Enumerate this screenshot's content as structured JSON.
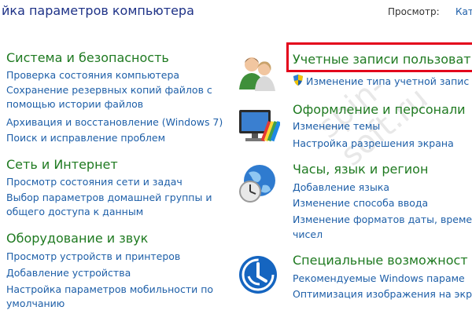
{
  "header": {
    "title": "йка параметров компьютера",
    "view_label": "Просмотр:",
    "view_value": "Кат"
  },
  "left": [
    {
      "title": "Система и безопасность",
      "links": [
        "Проверка состояния компьютера",
        "Сохранение резервных копий файлов с",
        "помощью истории файлов",
        "Архивация и восстановление (Windows 7)",
        "Поиск и исправление проблем"
      ]
    },
    {
      "title": "Сеть и Интернет",
      "links": [
        "Просмотр состояния сети и задач",
        "Выбор параметров домашней группы и",
        "общего доступа к данным"
      ]
    },
    {
      "title": "Оборудование и звук",
      "links": [
        "Просмотр устройств и принтеров",
        "Добавление устройства",
        "Настройка параметров мобильности по",
        "умолчанию"
      ]
    }
  ],
  "right": [
    {
      "title": "Учетные записи пользоват",
      "links": [
        "Изменение типа учетной запис"
      ],
      "icon": "users-icon"
    },
    {
      "title": "Оформление и персонали",
      "links": [
        "Изменение темы",
        "Настройка разрешения экрана"
      ],
      "icon": "appearance-icon"
    },
    {
      "title": "Часы, язык и регион",
      "links": [
        "Добавление языка",
        "Изменение способа ввода",
        "Изменение форматов даты, време",
        "чисел"
      ],
      "icon": "clock-globe-icon"
    },
    {
      "title": "Специальные возможност",
      "links": [
        "Рекомендуемые Windows параме",
        "Оптимизация изображения на экр"
      ],
      "icon": "ease-of-access-icon"
    }
  ],
  "watermark": "spin-soft.ru",
  "colors": {
    "link": "#1e5fa8",
    "category": "#1f7a21",
    "title": "#1e3287",
    "highlight": "#e3001b"
  }
}
